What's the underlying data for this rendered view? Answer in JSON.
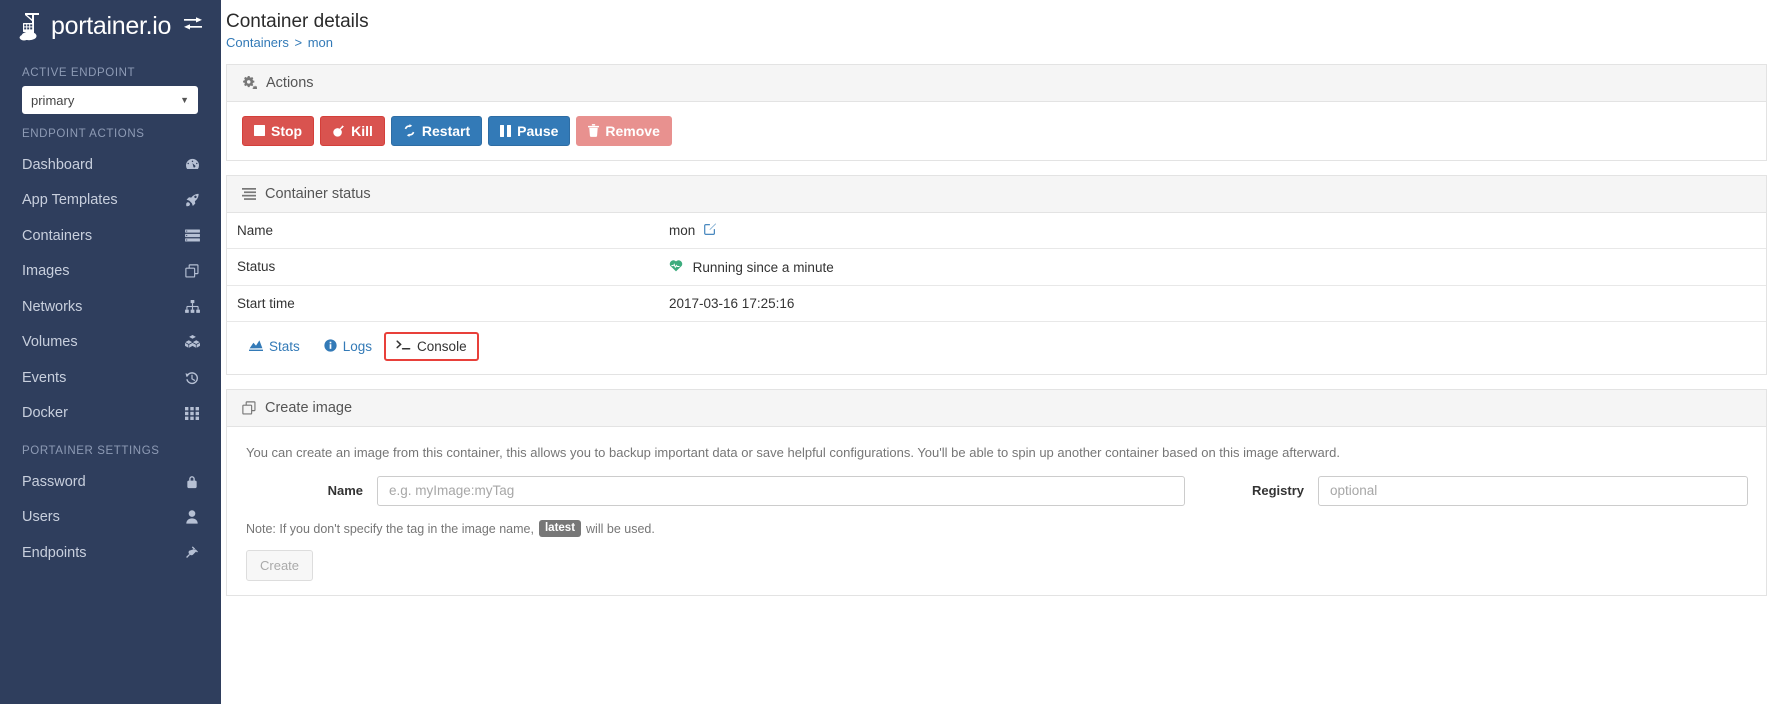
{
  "sidebar": {
    "brand": "portainer.io",
    "toggle_icon": "collapse-toggle-icon",
    "active_endpoint_heading": "ACTIVE ENDPOINT",
    "endpoint_value": "primary",
    "endpoint_actions_heading": "ENDPOINT ACTIONS",
    "endpoint_items": [
      {
        "label": "Dashboard",
        "icon": "tachometer-icon"
      },
      {
        "label": "App Templates",
        "icon": "rocket-icon"
      },
      {
        "label": "Containers",
        "icon": "server-icon"
      },
      {
        "label": "Images",
        "icon": "clone-icon"
      },
      {
        "label": "Networks",
        "icon": "sitemap-icon"
      },
      {
        "label": "Volumes",
        "icon": "cubes-icon"
      },
      {
        "label": "Events",
        "icon": "history-icon"
      },
      {
        "label": "Docker",
        "icon": "th-icon"
      }
    ],
    "settings_heading": "PORTAINER SETTINGS",
    "settings_items": [
      {
        "label": "Password",
        "icon": "lock-icon"
      },
      {
        "label": "Users",
        "icon": "user-icon"
      },
      {
        "label": "Endpoints",
        "icon": "plug-icon"
      }
    ]
  },
  "header": {
    "title": "Container details",
    "breadcrumb_root": "Containers",
    "breadcrumb_sep": ">",
    "breadcrumb_current": "mon"
  },
  "actions_panel": {
    "title": "Actions",
    "icon": "cogs-icon",
    "buttons": [
      {
        "label": "Stop",
        "icon": "stop-icon",
        "style": "danger"
      },
      {
        "label": "Kill",
        "icon": "bomb-icon",
        "style": "danger"
      },
      {
        "label": "Restart",
        "icon": "refresh-icon",
        "style": "primary"
      },
      {
        "label": "Pause",
        "icon": "pause-icon",
        "style": "primary"
      },
      {
        "label": "Remove",
        "icon": "trash-icon",
        "style": "muted"
      }
    ]
  },
  "status_panel": {
    "title": "Container status",
    "icon": "list-icon",
    "rows": [
      {
        "key": "Name",
        "value": "mon",
        "value_icon": "edit-icon"
      },
      {
        "key": "Status",
        "value": "Running since a minute",
        "value_icon": "heartbeat-icon"
      },
      {
        "key": "Start time",
        "value": "2017-03-16 17:25:16",
        "value_icon": ""
      }
    ],
    "links": [
      {
        "label": "Stats",
        "icon": "area-chart-icon",
        "highlighted": false
      },
      {
        "label": "Logs",
        "icon": "info-circle-icon",
        "highlighted": false
      },
      {
        "label": "Console",
        "icon": "terminal-icon",
        "highlighted": true
      }
    ]
  },
  "create_image_panel": {
    "title": "Create image",
    "icon": "clone-icon",
    "description": "You can create an image from this container, this allows you to backup important data or save helpful configurations. You'll be able to spin up another container based on this image afterward.",
    "name_label": "Name",
    "name_placeholder": "e.g. myImage:myTag",
    "name_value": "",
    "registry_label": "Registry",
    "registry_placeholder": "optional",
    "registry_value": "",
    "note_prefix": "Note: If you don't specify the tag in the image name,",
    "note_tag": "latest",
    "note_suffix": "will be used.",
    "create_label": "Create"
  },
  "colors": {
    "sidebar_bg": "#2f3e5d",
    "danger": "#d9534f",
    "primary": "#337ab7",
    "muted": "#e8918f",
    "link": "#337ab7",
    "highlight_border": "#e8403a",
    "running_green": "#3dac7e"
  }
}
